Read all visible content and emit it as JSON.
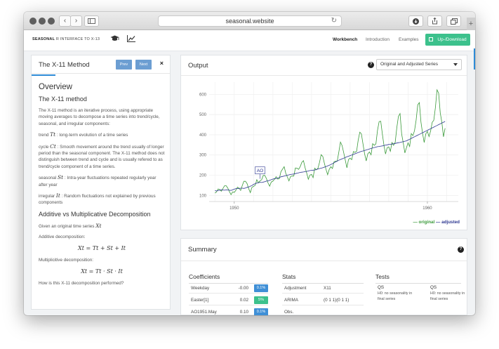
{
  "browser": {
    "url": "seasonal.website",
    "nav_back": "‹",
    "nav_forward": "›"
  },
  "navbar": {
    "brand_bold": "SEASONAL",
    "brand_rest": "R INTERFACE TO X-13",
    "links": [
      {
        "label": "Workbench",
        "active": true
      },
      {
        "label": "Introduction",
        "active": false
      },
      {
        "label": "Examples",
        "active": false
      }
    ],
    "updown_label": "Up-/Download"
  },
  "tour": {
    "title": "The X-11 Method",
    "prev_label": "Prev",
    "next_label": "Next",
    "close_label": "×",
    "overview_heading": "Overview",
    "method_heading": "The X-11 method",
    "intro": "The X-11 method is an iterative process, using appropriate moving averages to decompose a time series into trend/cycle, seasonal, and irregular components:",
    "trend_word": "trend",
    "trend_sym": "Tt",
    "trend_desc": ": long-term evolution of a time series",
    "cycle_word": "cycle",
    "cycle_sym": "Ct",
    "cycle_desc": ": Smooth movement around the trend usually of longer period than the seasonal component. The X-11 method does not distinguish between trend and cycle and is usually refered to as trend/cycle component of a time series.",
    "seasonal_word": "seasonal",
    "seasonal_sym": "St",
    "seasonal_desc": ": Intra-year fluctuations repeated regularly year after year",
    "irregular_word": "irregular",
    "irregular_sym": "It",
    "irregular_desc": ": Random fluctuations not explained by previous components",
    "add_mult_heading": "Additive vs Multiplicative Decomposition",
    "given_text": "Given an original time series",
    "given_sym": "Xt",
    "additive_label": "Additive decomposition:",
    "additive_eq": "Xt = Tt + St + It",
    "multiplicative_label": "Multiplicitive decomposition:",
    "multiplicative_eq": "Xt = Tt · St · It",
    "question": "How is this X-11 decomposition performed?"
  },
  "output": {
    "title": "Output",
    "help": "?",
    "view_select": "Original and Adjusted Series",
    "legend_original": "— original",
    "legend_adjusted": "— adjusted"
  },
  "chart_data": {
    "type": "line",
    "x_start": 1949,
    "x_step": 0.0833333,
    "xlim": [
      1948.7,
      1961.6
    ],
    "ylim": [
      70,
      660
    ],
    "x_ticks": [
      1950,
      1960
    ],
    "y_ticks": [
      100,
      200,
      300,
      400,
      500,
      600
    ],
    "grid": true,
    "annotation": {
      "label": "AO",
      "x": 1951.3333,
      "series": "original"
    },
    "series": [
      {
        "name": "original",
        "color": "#3a9a3a",
        "values": [
          112,
          118,
          132,
          129,
          121,
          135,
          148,
          148,
          136,
          119,
          104,
          118,
          115,
          126,
          141,
          135,
          125,
          149,
          170,
          170,
          158,
          133,
          114,
          140,
          145,
          150,
          178,
          163,
          172,
          178,
          199,
          199,
          184,
          162,
          146,
          166,
          171,
          180,
          193,
          181,
          183,
          218,
          230,
          242,
          209,
          191,
          172,
          194,
          196,
          196,
          236,
          235,
          229,
          243,
          264,
          272,
          237,
          211,
          180,
          201,
          204,
          188,
          235,
          227,
          234,
          264,
          302,
          293,
          259,
          229,
          203,
          229,
          242,
          233,
          267,
          269,
          270,
          315,
          364,
          347,
          312,
          274,
          237,
          278,
          284,
          277,
          317,
          313,
          318,
          374,
          413,
          405,
          355,
          306,
          271,
          306,
          315,
          301,
          356,
          348,
          355,
          422,
          465,
          467,
          404,
          347,
          305,
          336,
          340,
          318,
          362,
          348,
          363,
          435,
          491,
          505,
          404,
          359,
          310,
          337,
          360,
          342,
          406,
          396,
          420,
          472,
          548,
          559,
          463,
          407,
          362,
          405,
          417,
          391,
          419,
          461,
          472,
          535,
          622,
          606,
          508,
          461,
          390,
          432
        ]
      },
      {
        "name": "adjusted",
        "color": "#2c3690",
        "values": [
          124,
          122,
          124,
          126,
          128,
          127,
          126,
          128,
          127,
          126,
          125,
          128,
          131,
          134,
          134,
          135,
          136,
          136,
          135,
          137,
          140,
          142,
          146,
          149,
          155,
          158,
          161,
          163,
          165,
          164,
          166,
          168,
          171,
          172,
          175,
          178,
          181,
          183,
          184,
          186,
          189,
          192,
          194,
          196,
          198,
          200,
          202,
          204,
          205,
          206,
          208,
          210,
          212,
          214,
          215,
          216,
          218,
          219,
          221,
          223,
          224,
          225,
          226,
          228,
          231,
          233,
          235,
          237,
          240,
          243,
          246,
          249,
          253,
          257,
          262,
          266,
          270,
          274,
          278,
          281,
          284,
          288,
          291,
          294,
          297,
          300,
          303,
          306,
          309,
          312,
          315,
          318,
          320,
          322,
          325,
          327,
          330,
          332,
          335,
          337,
          339,
          341,
          342,
          344,
          345,
          347,
          349,
          350,
          352,
          353,
          354,
          356,
          357,
          359,
          361,
          362,
          364,
          366,
          368,
          370,
          374,
          378,
          382,
          386,
          390,
          394,
          398,
          402,
          406,
          410,
          414,
          418,
          422,
          426,
          430,
          434,
          438,
          442,
          446,
          450,
          454,
          458,
          462,
          466
        ]
      }
    ]
  },
  "summary": {
    "title": "Summary",
    "help": "?",
    "coefficients_heading": "Coefficients",
    "coefficients": [
      {
        "name": "Weekday",
        "value": "-0.00",
        "pvalue": "0.1%",
        "color": "#3f8fd6"
      },
      {
        "name": "Easter[1]",
        "value": "0.02",
        "pvalue": "5%",
        "color": "#3cc18c"
      },
      {
        "name": "AO1951.May",
        "value": "0.10",
        "pvalue": "0.1%",
        "color": "#3f8fd6"
      }
    ],
    "stats_heading": "Stats",
    "stats": [
      {
        "key": "Adjustment",
        "value": "X11"
      },
      {
        "key": "ARIMA",
        "value": "(0 1 1)(0 1 1)"
      },
      {
        "key": "Obs.",
        "value": ""
      }
    ],
    "tests_heading": "Tests",
    "tests": [
      {
        "name": "QS",
        "desc": "H0: no seasonality in final series"
      },
      {
        "name": "QS",
        "desc": "H0: no seasonality in final series"
      }
    ]
  }
}
